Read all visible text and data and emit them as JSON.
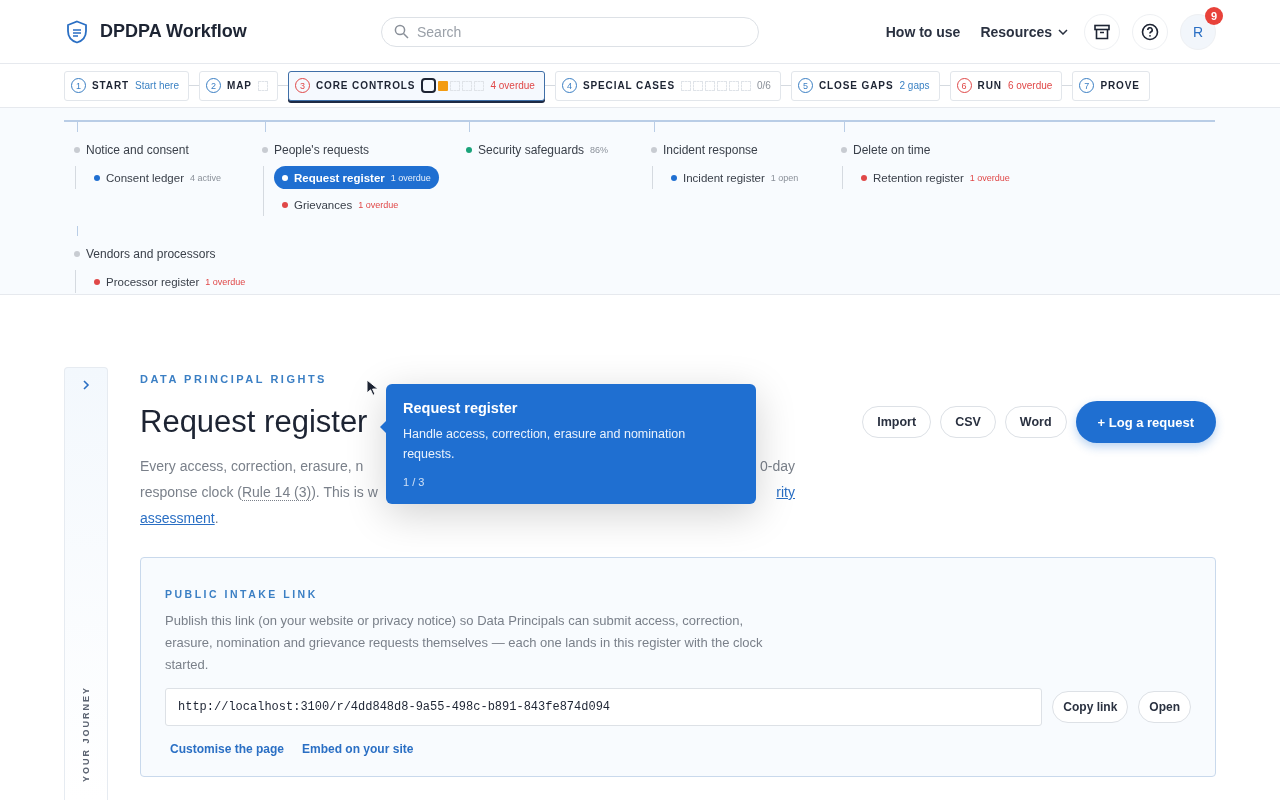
{
  "header": {
    "brand": "DPDPA Workflow",
    "search": {
      "placeholder": "Search"
    },
    "nav": [
      {
        "label": "How to use",
        "kind": "link"
      },
      {
        "label": "Resources",
        "kind": "menu"
      }
    ],
    "avatar": {
      "initial": "R",
      "badge": "9"
    }
  },
  "steps": [
    {
      "number": "1",
      "kind": "normal",
      "label": "START",
      "note": {
        "text": "Start here",
        "kind": "info"
      },
      "selected": false
    },
    {
      "number": "2",
      "kind": "normal",
      "label": "MAP",
      "selected": false,
      "segments": [
        {
          "kind": "empty"
        }
      ]
    },
    {
      "number": "3",
      "kind": "alert",
      "label": "CORE CONTROLS",
      "note": {
        "text": "4 overdue",
        "kind": "danger"
      },
      "selected": true,
      "segments": [
        {
          "kind": "current"
        },
        {
          "kind": "warn"
        },
        {
          "kind": "empty"
        },
        {
          "kind": "empty"
        },
        {
          "kind": "empty"
        }
      ]
    },
    {
      "number": "4",
      "kind": "normal",
      "label": "SPECIAL CASES",
      "note": {
        "text": "0/6",
        "kind": "muted"
      },
      "selected": false,
      "segments": [
        {
          "kind": "empty"
        },
        {
          "kind": "empty"
        },
        {
          "kind": "empty"
        },
        {
          "kind": "empty"
        },
        {
          "kind": "empty"
        },
        {
          "kind": "empty"
        }
      ]
    },
    {
      "number": "5",
      "kind": "normal",
      "label": "CLOSE GAPS",
      "note": {
        "text": "2 gaps",
        "kind": "info"
      },
      "selected": false
    },
    {
      "number": "6",
      "kind": "alert",
      "label": "RUN",
      "note": {
        "text": "6 overdue",
        "kind": "danger"
      },
      "selected": false
    },
    {
      "number": "7",
      "kind": "normal",
      "label": "PROVE",
      "selected": false
    }
  ],
  "groups": [
    {
      "name": "Notice and consent",
      "color": "#c8ccd2",
      "children": [
        {
          "name": "Consent ledger",
          "badge": {
            "text": "4 active",
            "kind": "muted"
          },
          "color": "#1f6fd1",
          "selected": false
        }
      ]
    },
    {
      "name": "People's requests",
      "color": "#c8ccd2",
      "children": [
        {
          "name": "Request register",
          "badge": {
            "text": "1 overdue",
            "kind": "danger"
          },
          "color": "#ffffff",
          "selected": true
        },
        {
          "name": "Grievances",
          "badge": {
            "text": "1 overdue",
            "kind": "danger"
          },
          "color": "#e04848",
          "selected": false
        }
      ]
    },
    {
      "name": "Security safeguards",
      "badge": "86%",
      "color": "#1aa37a"
    },
    {
      "name": "Incident response",
      "color": "#c8ccd2",
      "children": [
        {
          "name": "Incident register",
          "badge": {
            "text": "1 open",
            "kind": "muted"
          },
          "color": "#1f6fd1",
          "selected": false
        }
      ]
    },
    {
      "name": "Delete on time",
      "color": "#c8ccd2",
      "children": [
        {
          "name": "Retention register",
          "badge": {
            "text": "1 overdue",
            "kind": "danger"
          },
          "color": "#e04848",
          "selected": false
        }
      ]
    },
    {
      "name": "Vendors and processors",
      "color": "#c8ccd2",
      "children": [
        {
          "name": "Processor register",
          "badge": {
            "text": "1 overdue",
            "kind": "danger"
          },
          "color": "#e04848",
          "selected": false
        }
      ]
    }
  ],
  "sidebar": {
    "label": "YOUR JOURNEY"
  },
  "page": {
    "eyebrow": "DATA PRINCIPAL RIGHTS",
    "title": "Request register",
    "actions": [
      {
        "label": "Import",
        "kind": "secondary"
      },
      {
        "label": "CSV",
        "kind": "secondary"
      },
      {
        "label": "Word",
        "kind": "secondary"
      },
      {
        "label": "+ Log a request",
        "kind": "primary"
      }
    ],
    "description_lines": [
      {
        "left": [
          {
            "text": "Every access, correction, erasure, n",
            "kind": "text"
          }
        ],
        "right": [
          {
            "text": "0-day",
            "kind": "text"
          }
        ]
      },
      {
        "left": [
          {
            "text": "response clock (",
            "kind": "text"
          },
          {
            "text": "Rule 14 (3)",
            "kind": "ref"
          },
          {
            "text": "). This is w",
            "kind": "text"
          }
        ],
        "right": [
          {
            "text": "rity",
            "kind": "link"
          }
        ]
      },
      {
        "left": [
          {
            "text": "assessment",
            "kind": "link"
          },
          {
            "text": ".",
            "kind": "text"
          }
        ]
      }
    ]
  },
  "tooltip": {
    "title": "Request register",
    "body": "Handle access, correction, erasure and nomination requests.",
    "counter": "1 / 3"
  },
  "intake": {
    "heading": "PUBLIC INTAKE LINK",
    "text": "Publish this link (on your website or privacy notice) so Data Principals can submit access, correction, erasure, nomination and grievance requests themselves — each one lands in this register with the clock started.",
    "url": "http://localhost:3100/r/4dd848d8-9a55-498c-b891-843fe874d094",
    "buttons": [
      "Copy link",
      "Open"
    ],
    "links": [
      "Customise the page",
      "Embed on your site"
    ]
  }
}
